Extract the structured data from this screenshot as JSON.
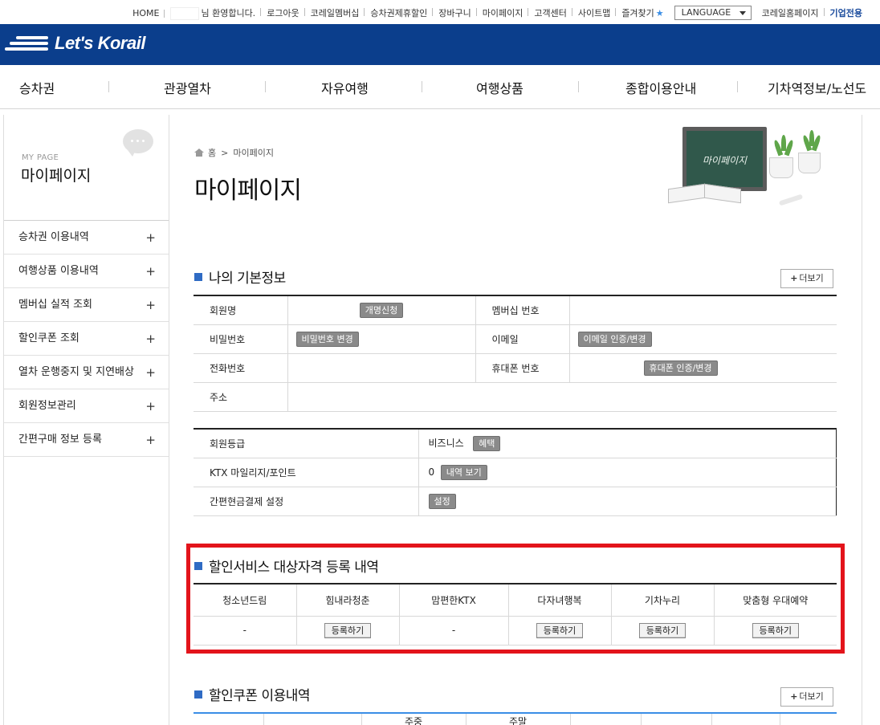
{
  "util": {
    "home": "HOME",
    "welcome": "님 환영합니다.",
    "links": [
      "로그아웃",
      "코레일멤버십",
      "승차권제휴할인",
      "장바구니",
      "마이페이지",
      "고객센터",
      "사이트맵"
    ],
    "favorites": "즐겨찾기",
    "language": "LANGUAGE",
    "korail_home": "코레일홈페이지",
    "corporate": "기업전용"
  },
  "brand": {
    "logo_text": "Let's Korail"
  },
  "gnb": [
    "승차권",
    "관광열차",
    "자유여행",
    "여행상품",
    "종합이용안내",
    "기차역정보/노선도"
  ],
  "sidebar": {
    "sub": "MY PAGE",
    "title": "마이페이지",
    "items": [
      {
        "label": "승차권 이용내역"
      },
      {
        "label": "여행상품 이용내역"
      },
      {
        "label": "멤버십 실적 조회"
      },
      {
        "label": "할인쿠폰 조회"
      },
      {
        "label": "열차 운행중지 및 지연배상"
      },
      {
        "label": "회원정보관리"
      },
      {
        "label": "간편구매 정보 등록"
      }
    ]
  },
  "breadcrumb": {
    "home": "홈",
    "current": "마이페이지"
  },
  "page_title": "마이페이지",
  "illustration_text": "마이페이지",
  "basic_info": {
    "heading": "나의 기본정보",
    "more": "더보기",
    "rows": [
      {
        "l1": "회원명",
        "btn1": "개명신청",
        "l2": "멤버십 번호",
        "v2": ""
      },
      {
        "l1": "비밀번호",
        "btn1": "비밀번호 변경",
        "l2": "이메일",
        "btn2": "이메일 인증/변경"
      },
      {
        "l1": "전화번호",
        "l2": "휴대폰 번호",
        "btn2": "휴대폰 인증/변경"
      },
      {
        "l1": "주소"
      }
    ]
  },
  "grade": {
    "rows": [
      {
        "label": "회원등급",
        "value": "비즈니스",
        "btn": "혜택"
      },
      {
        "label": "KTX 마일리지/포인트",
        "value": "0",
        "btn": "내역 보기"
      },
      {
        "label": "간편현금결제 설정",
        "value": "",
        "btn": "설정"
      }
    ]
  },
  "discount": {
    "heading": "할인서비스 대상자격 등록 내역",
    "headers": [
      "청소년드림",
      "힘내라청춘",
      "맘편한KTX",
      "다자녀행복",
      "기차누리",
      "맞춤형 우대예약"
    ],
    "cells": [
      "-",
      "등록하기",
      "-",
      "등록하기",
      "등록하기",
      "등록하기"
    ]
  },
  "coupon": {
    "heading": "할인쿠폰 이용내역",
    "more": "더보기",
    "partial_headers": [
      "",
      "",
      "주중",
      "주말",
      "",
      "",
      "",
      ""
    ]
  },
  "colors": {
    "brand": "#0b3e8c",
    "highlight": "#e3141b",
    "bullet": "#2f6bc4"
  }
}
